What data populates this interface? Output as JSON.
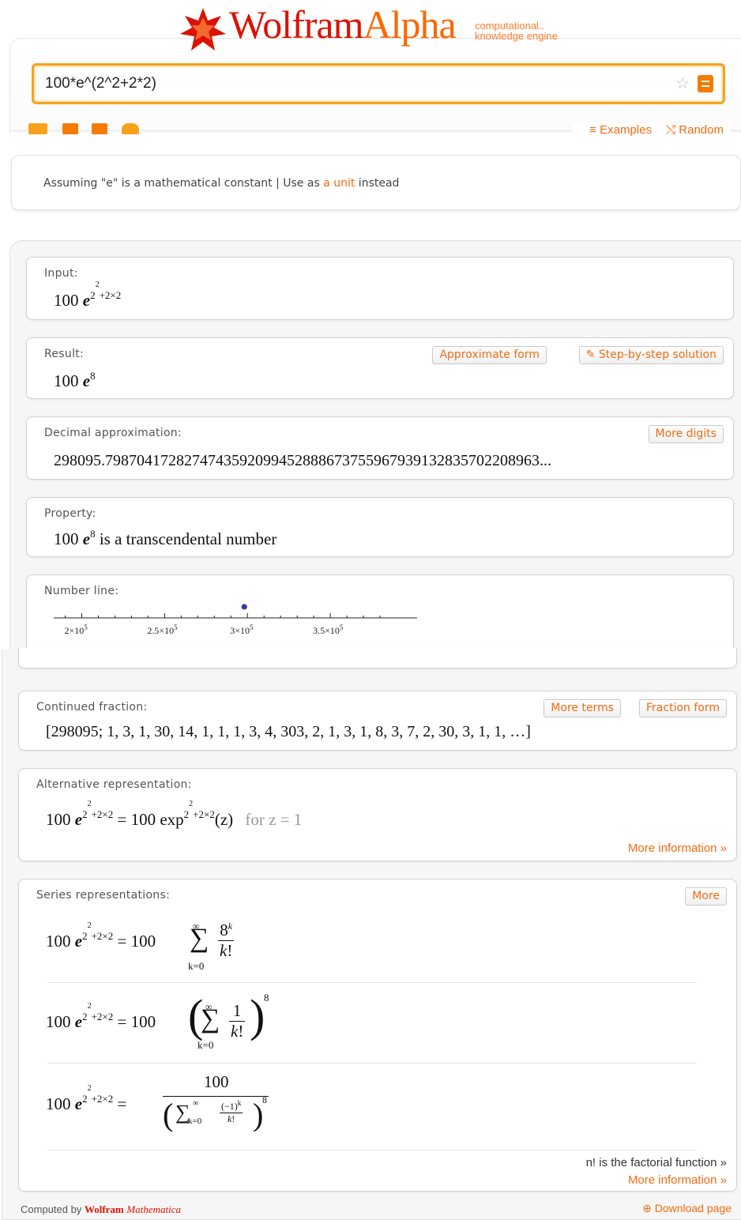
{
  "header": {
    "brand_wolfram": "Wolfram",
    "brand_alpha": "Alpha",
    "tagline_1": "computational..",
    "tagline_2": "knowledge engine"
  },
  "search": {
    "query": "100*e^(2^2+2*2)"
  },
  "toolbar": {
    "examples_label": "≡ Examples",
    "random_label": "⤭ Random"
  },
  "assumption": {
    "prefix": "Assuming \"e\" is a mathematical constant | Use as ",
    "link": "a unit",
    "suffix": " instead"
  },
  "pods": {
    "input": {
      "title": "Input:",
      "base": "100 ",
      "e": "e",
      "exp": "2",
      "exp_exp": "2",
      "exp_rest": "+2×2"
    },
    "result": {
      "title": "Result:",
      "base": "100 ",
      "e": "e",
      "exp": "8",
      "btn_approx": "Approximate form",
      "btn_step": "Step-by-step solution"
    },
    "decimal": {
      "title": "Decimal approximation:",
      "value": "298095.7987041728274743592099452888673755967939132835702208963...",
      "btn_more": "More digits"
    },
    "property": {
      "title": "Property:",
      "base": "100 ",
      "e": "e",
      "exp": "8",
      "text": " is a transcendental number"
    },
    "numberline": {
      "title": "Number line:",
      "ticks": [
        "2×10",
        "2.5×10",
        "3×10",
        "3.5×10"
      ],
      "tick_exp": "5",
      "point_value": 298095.8
    },
    "continued": {
      "title": "Continued fraction:",
      "value": "[298095; 1, 3, 1, 30, 14, 1, 1, 1, 3, 4, 303, 2, 1, 3, 1, 8, 3, 7, 2, 30, 3, 1, 1, …]",
      "btn_terms": "More terms",
      "btn_fraction": "Fraction form"
    },
    "alternative": {
      "title": "Alternative representation:",
      "lhs": "100 ",
      "eq": " = 100 exp",
      "arg": "(z)",
      "cond": "for z = 1",
      "more_info": "More information »"
    },
    "series": {
      "title": "Series representations:",
      "btn_more": "More",
      "lhs": "100 ",
      "eq1_rhs": "= 100",
      "eq2_rhs": "= 100",
      "eq3_num": "100",
      "factorial_note": "n! is the factorial function »",
      "more_info": "More information »"
    }
  },
  "footer": {
    "computed_by": "Computed by ",
    "wolfram": "Wolfram",
    "mathematica": "Mathematica",
    "download": "Download page"
  }
}
